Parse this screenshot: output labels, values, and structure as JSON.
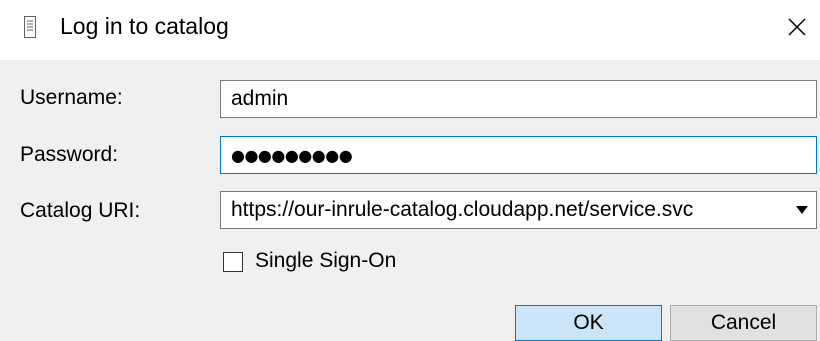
{
  "window": {
    "title": "Log in to catalog",
    "close_icon": "close-icon",
    "app_icon": "notepad-icon"
  },
  "form": {
    "username": {
      "label": "Username:",
      "value": "admin"
    },
    "password": {
      "label": "Password:",
      "value": "●●●●●●●●●"
    },
    "catalog_uri": {
      "label": "Catalog URI:",
      "value": "https://our-inrule-catalog.cloudapp.net/service.svc"
    },
    "single_sign_on": {
      "label": "Single Sign-On",
      "checked": false
    }
  },
  "buttons": {
    "ok_label": "OK",
    "cancel_label": "Cancel"
  },
  "colors": {
    "accent": "#0078d7",
    "ok_background": "#cce4f7",
    "body_background": "#f0f0f0"
  }
}
